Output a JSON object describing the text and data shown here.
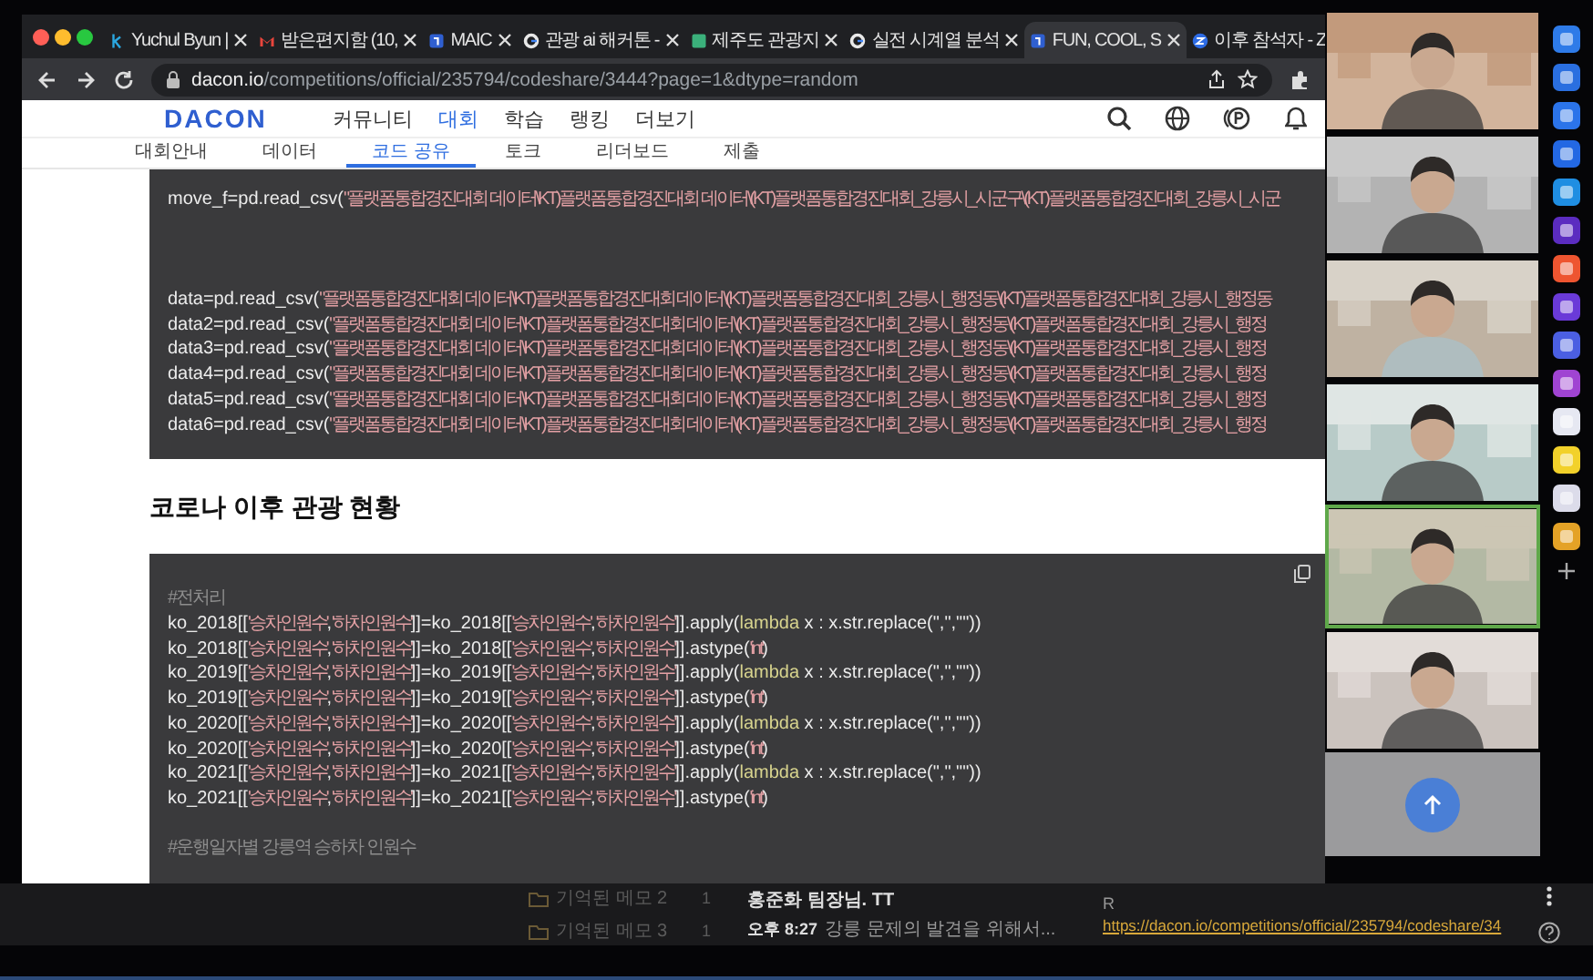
{
  "browser": {
    "tabs": [
      {
        "title": "Yuchul Byun |",
        "selected": false
      },
      {
        "title": "받은편지함 (10,",
        "selected": false
      },
      {
        "title": "MAIC",
        "selected": false
      },
      {
        "title": "관광 ai 해커톤 -",
        "selected": false
      },
      {
        "title": "제주도 관광지",
        "selected": false
      },
      {
        "title": "실전 시계열 분석",
        "selected": false
      },
      {
        "title": "FUN, COOL, S",
        "selected": true
      },
      {
        "title": "이후 참석자 - Z",
        "selected": false
      }
    ],
    "url_host": "dacon.io",
    "url_path": "/competitions/official/235794/codeshare/3444?page=1&dtype=random"
  },
  "page": {
    "logo": "DACON",
    "nav": [
      {
        "label": "커뮤니티",
        "selected": false
      },
      {
        "label": "대회",
        "selected": true
      },
      {
        "label": "학습",
        "selected": false
      },
      {
        "label": "랭킹",
        "selected": false
      },
      {
        "label": "더보기",
        "selected": false
      }
    ],
    "subnav": [
      {
        "label": "대회안내",
        "selected": false
      },
      {
        "label": "데이터",
        "selected": false
      },
      {
        "label": "코드 공유",
        "selected": true
      },
      {
        "label": "토크",
        "selected": false
      },
      {
        "label": "리더보드",
        "selected": false
      },
      {
        "label": "제출",
        "selected": false
      }
    ],
    "code_blocks": [
      {
        "lines": [
          {
            "kind": "text",
            "segments": [
              {
                "kind": "code",
                "text": "move_f=pd.read_csv("
              },
              {
                "kind": "string",
                "text": "\"플랫폼통합경진대회 데이터\\KT)플랫폼통합경진대회 데이터\\(KT)플랫폼통합경진대회_강릉시_시군구\\(KT)플랫폼통합경진대회_강릉시_시군"
              }
            ]
          },
          {
            "kind": "blank"
          },
          {
            "kind": "blank"
          },
          {
            "kind": "blank"
          },
          {
            "kind": "text",
            "segments": [
              {
                "kind": "code",
                "text": "data=pd.read_csv("
              },
              {
                "kind": "string",
                "text": "\"플랫폼통합경진대회 데이터\\KT)플랫폼통합경진대회 데이터\\(KT)플랫폼통합경진대회_강릉시_행정동\\(KT)플랫폼통합경진대회_강릉시_행정동"
              }
            ]
          },
          {
            "kind": "text",
            "segments": [
              {
                "kind": "code",
                "text": "data2=pd.read_csv("
              },
              {
                "kind": "string",
                "text": "\"플랫폼통합경진대회 데이터\\KT)플랫폼통합경진대회 데이터\\(KT)플랫폼통합경진대회_강릉시_행정동\\(KT)플랫폼통합경진대회_강릉시_행정"
              }
            ]
          },
          {
            "kind": "text",
            "segments": [
              {
                "kind": "code",
                "text": "data3=pd.read_csv("
              },
              {
                "kind": "string",
                "text": "\"플랫폼통합경진대회 데이터\\KT)플랫폼통합경진대회 데이터\\(KT)플랫폼통합경진대회_강릉시_행정동\\(KT)플랫폼통합경진대회_강릉시_행정"
              }
            ]
          },
          {
            "kind": "text",
            "segments": [
              {
                "kind": "code",
                "text": "data4=pd.read_csv("
              },
              {
                "kind": "string",
                "text": "\"플랫폼통합경진대회 데이터\\KT)플랫폼통합경진대회 데이터\\(KT)플랫폼통합경진대회_강릉시_행정동\\(KT)플랫폼통합경진대회_강릉시_행정"
              }
            ]
          },
          {
            "kind": "text",
            "segments": [
              {
                "kind": "code",
                "text": "data5=pd.read_csv("
              },
              {
                "kind": "string",
                "text": "\"플랫폼통합경진대회 데이터\\KT)플랫폼통합경진대회 데이터\\(KT)플랫폼통합경진대회_강릉시_행정동\\(KT)플랫폼통합경진대회_강릉시_행정"
              }
            ]
          },
          {
            "kind": "text",
            "segments": [
              {
                "kind": "code",
                "text": "data6=pd.read_csv("
              },
              {
                "kind": "string",
                "text": "\"플랫폼통합경진대회 데이터\\KT)플랫폼통합경진대회 데이터\\(KT)플랫폼통합경진대회_강릉시_행정동\\(KT)플랫폼통합경진대회_강릉시_행정"
              }
            ]
          }
        ]
      },
      {
        "heading": "코로나 이후 관광 현황",
        "copy_button": true,
        "lines": [
          {
            "kind": "text",
            "segments": [
              {
                "kind": "comment",
                "text": "#전처리"
              }
            ]
          },
          {
            "kind": "text",
            "segments": [
              {
                "kind": "code",
                "text": "ko_2018[["
              },
              {
                "kind": "string",
                "text": "'승차인원수'"
              },
              {
                "kind": "code",
                "text": ","
              },
              {
                "kind": "string",
                "text": "'하차인원수'"
              },
              {
                "kind": "code",
                "text": "]]=ko_2018[["
              },
              {
                "kind": "string",
                "text": "'승차인원수'"
              },
              {
                "kind": "code",
                "text": ","
              },
              {
                "kind": "string",
                "text": "'하차인원수'"
              },
              {
                "kind": "code",
                "text": "]].apply("
              },
              {
                "kind": "keyword",
                "text": "lambda"
              },
              {
                "kind": "code",
                "text": " x : x.str.replace(\",\",\"\"))"
              }
            ]
          },
          {
            "kind": "text",
            "segments": [
              {
                "kind": "code",
                "text": "ko_2018[["
              },
              {
                "kind": "string",
                "text": "'승차인원수'"
              },
              {
                "kind": "code",
                "text": ","
              },
              {
                "kind": "string",
                "text": "'하차인원수'"
              },
              {
                "kind": "code",
                "text": "]]=ko_2018[["
              },
              {
                "kind": "string",
                "text": "'승차인원수'"
              },
              {
                "kind": "code",
                "text": ","
              },
              {
                "kind": "string",
                "text": "'하차인원수'"
              },
              {
                "kind": "code",
                "text": "]].astype("
              },
              {
                "kind": "string",
                "text": "'int'"
              },
              {
                "kind": "code",
                "text": ")"
              }
            ]
          },
          {
            "kind": "text",
            "segments": [
              {
                "kind": "code",
                "text": "ko_2019[["
              },
              {
                "kind": "string",
                "text": "'승차인원수'"
              },
              {
                "kind": "code",
                "text": ","
              },
              {
                "kind": "string",
                "text": "'하차인원수'"
              },
              {
                "kind": "code",
                "text": "]]=ko_2019[["
              },
              {
                "kind": "string",
                "text": "'승차인원수'"
              },
              {
                "kind": "code",
                "text": ","
              },
              {
                "kind": "string",
                "text": "'하차인원수'"
              },
              {
                "kind": "code",
                "text": "]].apply("
              },
              {
                "kind": "keyword",
                "text": "lambda"
              },
              {
                "kind": "code",
                "text": " x : x.str.replace(\",\",\"\"))"
              }
            ]
          },
          {
            "kind": "text",
            "segments": [
              {
                "kind": "code",
                "text": "ko_2019[["
              },
              {
                "kind": "string",
                "text": "'승차인원수'"
              },
              {
                "kind": "code",
                "text": ","
              },
              {
                "kind": "string",
                "text": "'하차인원수'"
              },
              {
                "kind": "code",
                "text": "]]=ko_2019[["
              },
              {
                "kind": "string",
                "text": "'승차인원수'"
              },
              {
                "kind": "code",
                "text": ","
              },
              {
                "kind": "string",
                "text": "'하차인원수'"
              },
              {
                "kind": "code",
                "text": "]].astype("
              },
              {
                "kind": "string",
                "text": "'int'"
              },
              {
                "kind": "code",
                "text": ")"
              }
            ]
          },
          {
            "kind": "text",
            "segments": [
              {
                "kind": "code",
                "text": "ko_2020[["
              },
              {
                "kind": "string",
                "text": "'승차인원수'"
              },
              {
                "kind": "code",
                "text": ","
              },
              {
                "kind": "string",
                "text": "'하차인원수'"
              },
              {
                "kind": "code",
                "text": "]]=ko_2020[["
              },
              {
                "kind": "string",
                "text": "'승차인원수'"
              },
              {
                "kind": "code",
                "text": ","
              },
              {
                "kind": "string",
                "text": "'하차인원수'"
              },
              {
                "kind": "code",
                "text": "]].apply("
              },
              {
                "kind": "keyword",
                "text": "lambda"
              },
              {
                "kind": "code",
                "text": " x : x.str.replace(\",\",\"\"))"
              }
            ]
          },
          {
            "kind": "text",
            "segments": [
              {
                "kind": "code",
                "text": "ko_2020[["
              },
              {
                "kind": "string",
                "text": "'승차인원수'"
              },
              {
                "kind": "code",
                "text": ","
              },
              {
                "kind": "string",
                "text": "'하차인원수'"
              },
              {
                "kind": "code",
                "text": "]]=ko_2020[["
              },
              {
                "kind": "string",
                "text": "'승차인원수'"
              },
              {
                "kind": "code",
                "text": ","
              },
              {
                "kind": "string",
                "text": "'하차인원수'"
              },
              {
                "kind": "code",
                "text": "]].astype("
              },
              {
                "kind": "string",
                "text": "'int'"
              },
              {
                "kind": "code",
                "text": ")"
              }
            ]
          },
          {
            "kind": "text",
            "segments": [
              {
                "kind": "code",
                "text": "ko_2021[["
              },
              {
                "kind": "string",
                "text": "'승차인원수'"
              },
              {
                "kind": "code",
                "text": ","
              },
              {
                "kind": "string",
                "text": "'하차인원수'"
              },
              {
                "kind": "code",
                "text": "]]=ko_2021[["
              },
              {
                "kind": "string",
                "text": "'승차인원수'"
              },
              {
                "kind": "code",
                "text": ","
              },
              {
                "kind": "string",
                "text": "'하차인원수'"
              },
              {
                "kind": "code",
                "text": "]].apply("
              },
              {
                "kind": "keyword",
                "text": "lambda"
              },
              {
                "kind": "code",
                "text": " x : x.str.replace(\",\",\"\"))"
              }
            ]
          },
          {
            "kind": "text",
            "segments": [
              {
                "kind": "code",
                "text": "ko_2021[["
              },
              {
                "kind": "string",
                "text": "'승차인원수'"
              },
              {
                "kind": "code",
                "text": ","
              },
              {
                "kind": "string",
                "text": "'하차인원수'"
              },
              {
                "kind": "code",
                "text": "]]=ko_2021[["
              },
              {
                "kind": "string",
                "text": "'승차인원수'"
              },
              {
                "kind": "code",
                "text": ","
              },
              {
                "kind": "string",
                "text": "'하차인원수'"
              },
              {
                "kind": "code",
                "text": "]].astype("
              },
              {
                "kind": "string",
                "text": "'int'"
              },
              {
                "kind": "code",
                "text": ")"
              }
            ]
          },
          {
            "kind": "blank"
          },
          {
            "kind": "text",
            "segments": [
              {
                "kind": "comment",
                "text": "#운행일자별 강릉역 승하차 인원수"
              }
            ]
          }
        ]
      }
    ]
  },
  "video_tiles": [
    {
      "speaking": false
    },
    {
      "speaking": false
    },
    {
      "speaking": false
    },
    {
      "speaking": false
    },
    {
      "speaking": true
    },
    {
      "speaking": false
    }
  ],
  "bottom": {
    "memos": [
      {
        "title": "기억된 메모 2",
        "count": "1"
      },
      {
        "title": "기억된 메모 3",
        "count": "1"
      }
    ],
    "chat": {
      "sender": "홍준화 팀장님. TT",
      "time": "오후 8:27",
      "preview": "강릉 문제의 발견을 위해서..."
    },
    "reply": {
      "initial": "R",
      "link": "https://dacon.io/competitions/official/235794/codeshare/34"
    }
  }
}
